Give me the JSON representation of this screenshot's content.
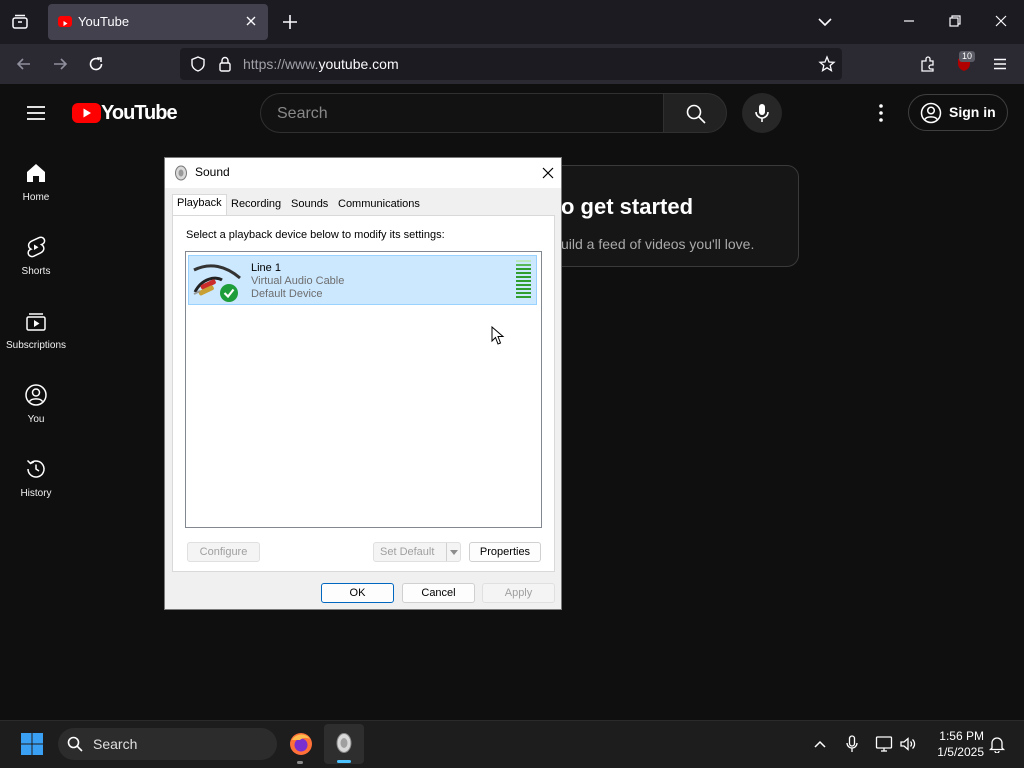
{
  "browser": {
    "tab_title": "YouTube",
    "url_prefix": "https://www.",
    "url_domain": "youtube.com",
    "extension_badge": "10"
  },
  "youtube": {
    "logo_text": "YouTube",
    "search_placeholder": "Search",
    "signin_label": "Sign in",
    "sidebar": [
      {
        "label": "Home",
        "icon": "home-icon"
      },
      {
        "label": "Shorts",
        "icon": "shorts-icon"
      },
      {
        "label": "Subscriptions",
        "icon": "subscriptions-icon"
      },
      {
        "label": "You",
        "icon": "you-icon"
      },
      {
        "label": "History",
        "icon": "history-icon"
      }
    ],
    "card_title": "o get started",
    "card_subtitle": "uild a feed of videos you'll love."
  },
  "dialog": {
    "title": "Sound",
    "tabs": [
      "Playback",
      "Recording",
      "Sounds",
      "Communications"
    ],
    "instruction": "Select a playback device below to modify its settings:",
    "device": {
      "name": "Line 1",
      "description": "Virtual Audio Cable",
      "status": "Default Device"
    },
    "buttons": {
      "configure": "Configure",
      "set_default": "Set Default",
      "properties": "Properties",
      "ok": "OK",
      "cancel": "Cancel",
      "apply": "Apply"
    }
  },
  "taskbar": {
    "search_label": "Search",
    "time": "1:56 PM",
    "date": "1/5/2025"
  }
}
